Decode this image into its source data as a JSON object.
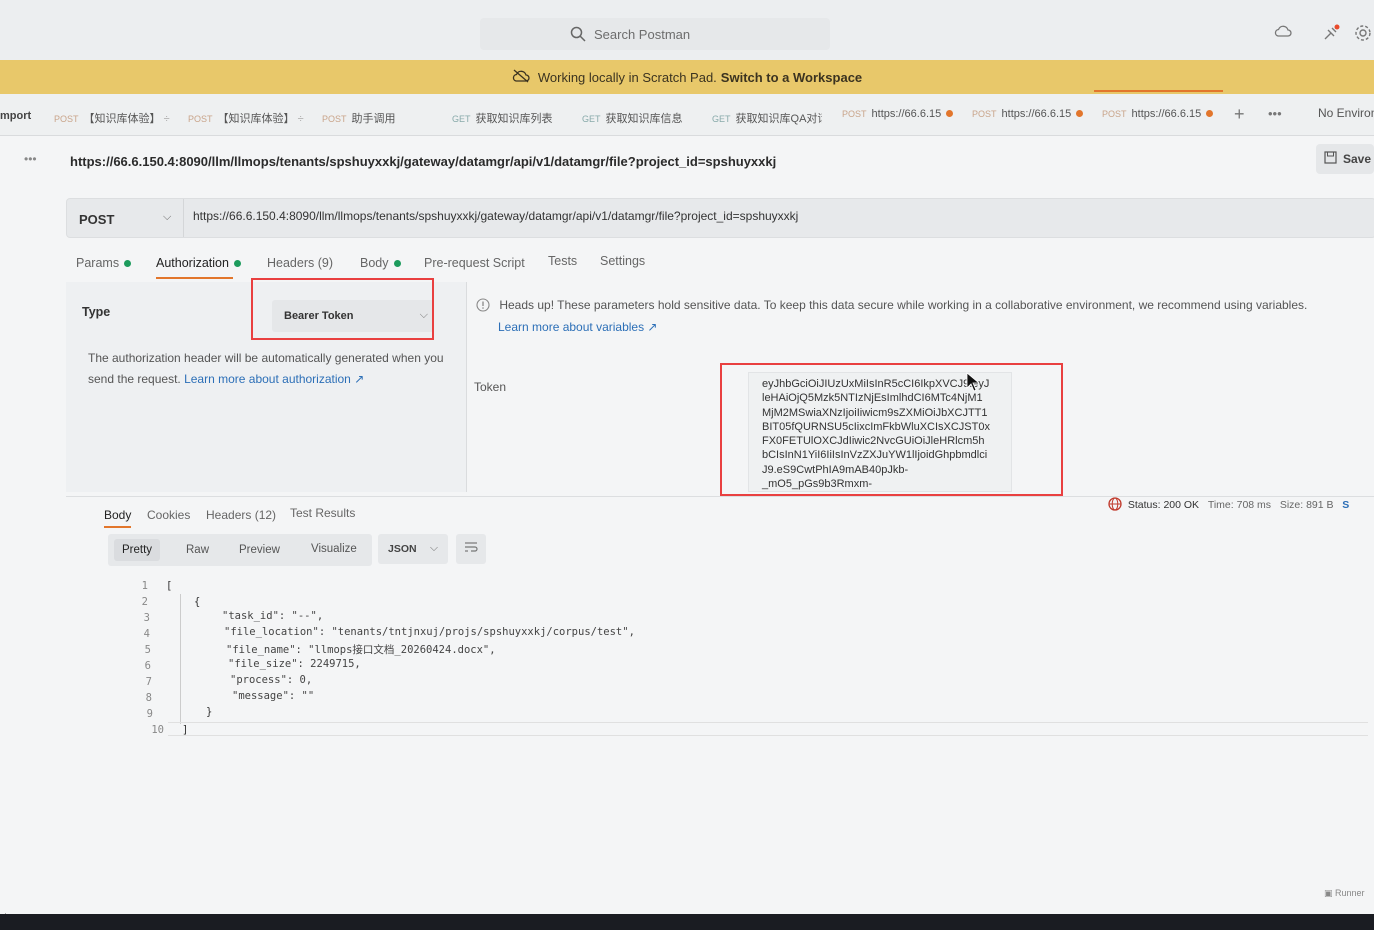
{
  "topbar": {
    "search_placeholder": "Search Postman",
    "icons": [
      "search-icon",
      "cloud-icon",
      "satellite-icon",
      "gear-icon"
    ]
  },
  "banner": {
    "text": "Working locally in Scratch Pad.",
    "link": "Switch to a Workspace"
  },
  "tabs": [
    {
      "method": "",
      "label": "mport"
    },
    {
      "method": "POST",
      "label": "【知识库体验】"
    },
    {
      "method": "POST",
      "label": "【知识库体验】"
    },
    {
      "method": "POST",
      "label": "助手调用"
    },
    {
      "method": "GET",
      "label": "获取知识库列表"
    },
    {
      "method": "GET",
      "label": "获取知识库信息"
    },
    {
      "method": "GET",
      "label": "获取知识库QA对话"
    },
    {
      "method": "POST",
      "label": "https://66.6.15"
    },
    {
      "method": "POST",
      "label": "https://66.6.15"
    },
    {
      "method": "POST",
      "label": "https://66.6.15"
    }
  ],
  "environment": "No Environ",
  "request": {
    "title": "https://66.6.150.4:8090/llm/llmops/tenants/spshuyxxkj/gateway/datamgr/api/v1/datamgr/file?project_id=spshuyxxkj",
    "method": "POST",
    "url": "https://66.6.150.4:8090/llm/llmops/tenants/spshuyxxkj/gateway/datamgr/api/v1/datamgr/file?project_id=spshuyxxkj",
    "save_label": "Save"
  },
  "request_tabs": {
    "params": "Params",
    "authorization": "Authorization",
    "headers": "Headers (9)",
    "body": "Body",
    "prerequest": "Pre-request Script",
    "tests": "Tests",
    "settings": "Settings"
  },
  "auth": {
    "type_label": "Type",
    "type_value": "Bearer Token",
    "desc": "The authorization header will be automatically generated when you send the request.",
    "desc_link": "Learn more about authorization ↗",
    "heads_up": "Heads up! These parameters hold sensitive data. To keep this data secure while working in a collaborative environment, we recommend using variables.",
    "learn_vars": "Learn more about variables ↗",
    "token_label": "Token",
    "token_value": "eyJhbGciOiJIUzUxMiIsInR5cCI6IkpXVCJ9.eyJ\nleHAiOjQ5Mzk5NTIzNjEsImlhdCI6MTc4NjM1\nMjM2MSwiaXNzIjoiIiwicm9sZXMiOiJbXCJTT1\nBIT05fQURNSU5cIixcImFkbWluXCIsXCJST0x\nFX0FETUlOXCJdIiwic2NvcGUiOiJleHRlcm5h\nbCIsInN1YiI6IiIsInVzZXJuYW1lIjoidGhpbmdlci\nJ9.eS9CwtPhIA9mAB40pJkb-\n_mO5_pGs9b3Rmxm-"
  },
  "response_tabs": {
    "body": "Body",
    "cookies": "Cookies",
    "headers": "Headers (12)",
    "tests": "Test Results"
  },
  "response_status": {
    "status": "Status: 200 OK",
    "time": "Time: 708 ms",
    "size": "Size: 891 B",
    "extra": "S"
  },
  "format_bar": {
    "pretty": "Pretty",
    "raw": "Raw",
    "preview": "Preview",
    "visualize": "Visualize",
    "json": "JSON"
  },
  "response_body": {
    "line_numbers": [
      "1",
      "2",
      "3",
      "4",
      "5",
      "6",
      "7",
      "8",
      "9",
      "10"
    ],
    "lines": [
      "[",
      "{",
      "\"task_id\": \"--\",",
      "\"file_location\": \"tenants/tntjnxuj/projs/spshuyxxkj/corpus/test\",",
      "\"file_name\": \"llmops接口文档_20260424.docx\",",
      "\"file_size\": 2249715,",
      "\"process\": 0,",
      "\"message\": \"\"",
      "}",
      "]"
    ]
  },
  "footer": {
    "runner": "Runner",
    "corner": "ole"
  }
}
